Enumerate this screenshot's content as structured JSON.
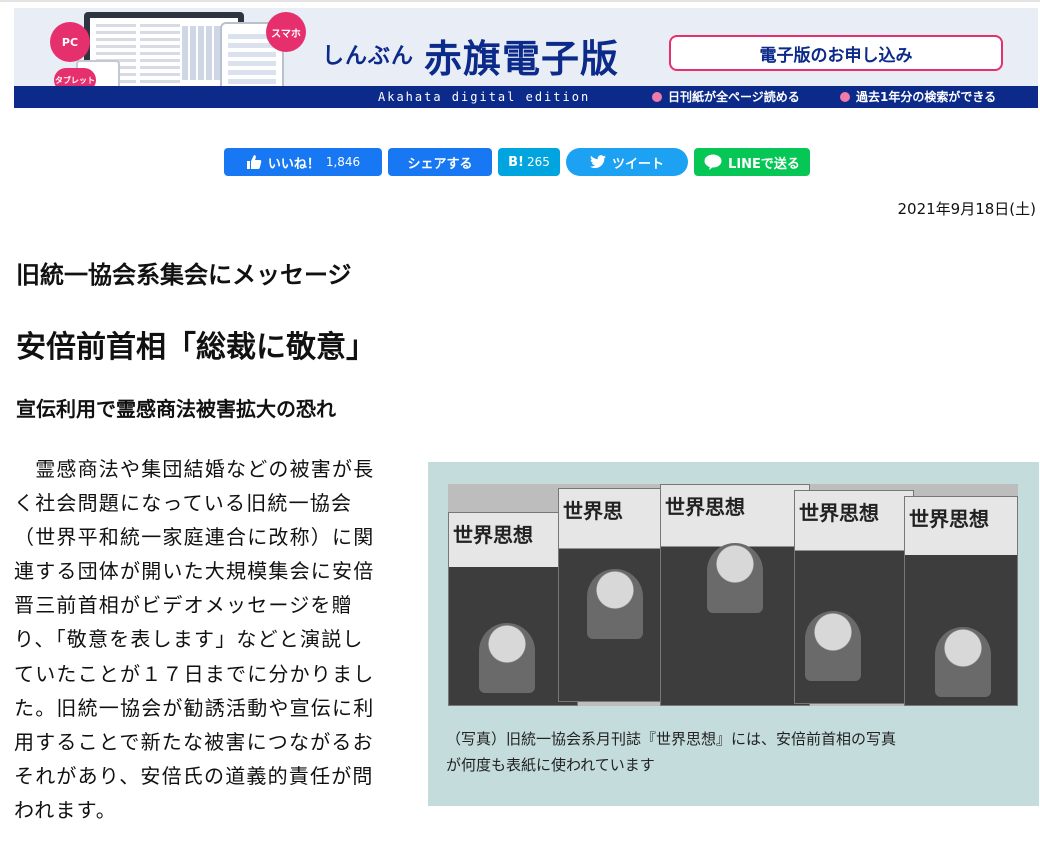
{
  "banner": {
    "badge_pc": "PC",
    "badge_phone": "スマホ",
    "badge_tablet": "タブレット",
    "logo_kana": "しんぶん",
    "logo_main": "赤旗電子版",
    "logo_sub": "Akahata digital edition",
    "apply_label": "電子版のお申し込み",
    "feature_1": "日刊紙が全ページ読める",
    "feature_2": "過去1年分の検索ができる",
    "colors": {
      "navy": "#0b2a8a",
      "pink": "#e6306e"
    }
  },
  "share": {
    "facebook_like": "いいね！",
    "facebook_count": "1,846",
    "facebook_share": "シェアする",
    "hatena_label": "B!",
    "hatena_count": "265",
    "tweet": "ツイート",
    "line": "LINEで送る"
  },
  "article": {
    "date": "2021年9月18日(土)",
    "headline_1": "旧統一協会系集会にメッセージ",
    "headline_2": "安倍前首相「総裁に敬意」",
    "headline_3": "宣伝利用で霊感商法被害拡大の恐れ",
    "body_lines": [
      "　霊感商法や集団結婚などの被害が長",
      "く社会問題になっている旧統一協会",
      "（世界平和統一家庭連合に改称）に関",
      "連する団体が開いた大規模集会に安倍",
      "晋三前首相がビデオメッセージを贈",
      "り、「敬意を表します」などと演説し",
      "ていたことが１７日までに分かりまし",
      "た。旧統一協会が勧誘活動や宣伝に利",
      "用することで新たな被害につながるお",
      "それがあり、安倍氏の道義的責任が問",
      "われます。"
    ]
  },
  "photo": {
    "magazine_titles": [
      "世界思想",
      "世界思",
      "世界思想",
      "世界思想",
      "世界思想"
    ],
    "caption_line_1": "（写真）旧統一協会系月刊誌『世界思想』には、安倍前首相の写真",
    "caption_line_2": "が何度も表紙に使われています"
  }
}
